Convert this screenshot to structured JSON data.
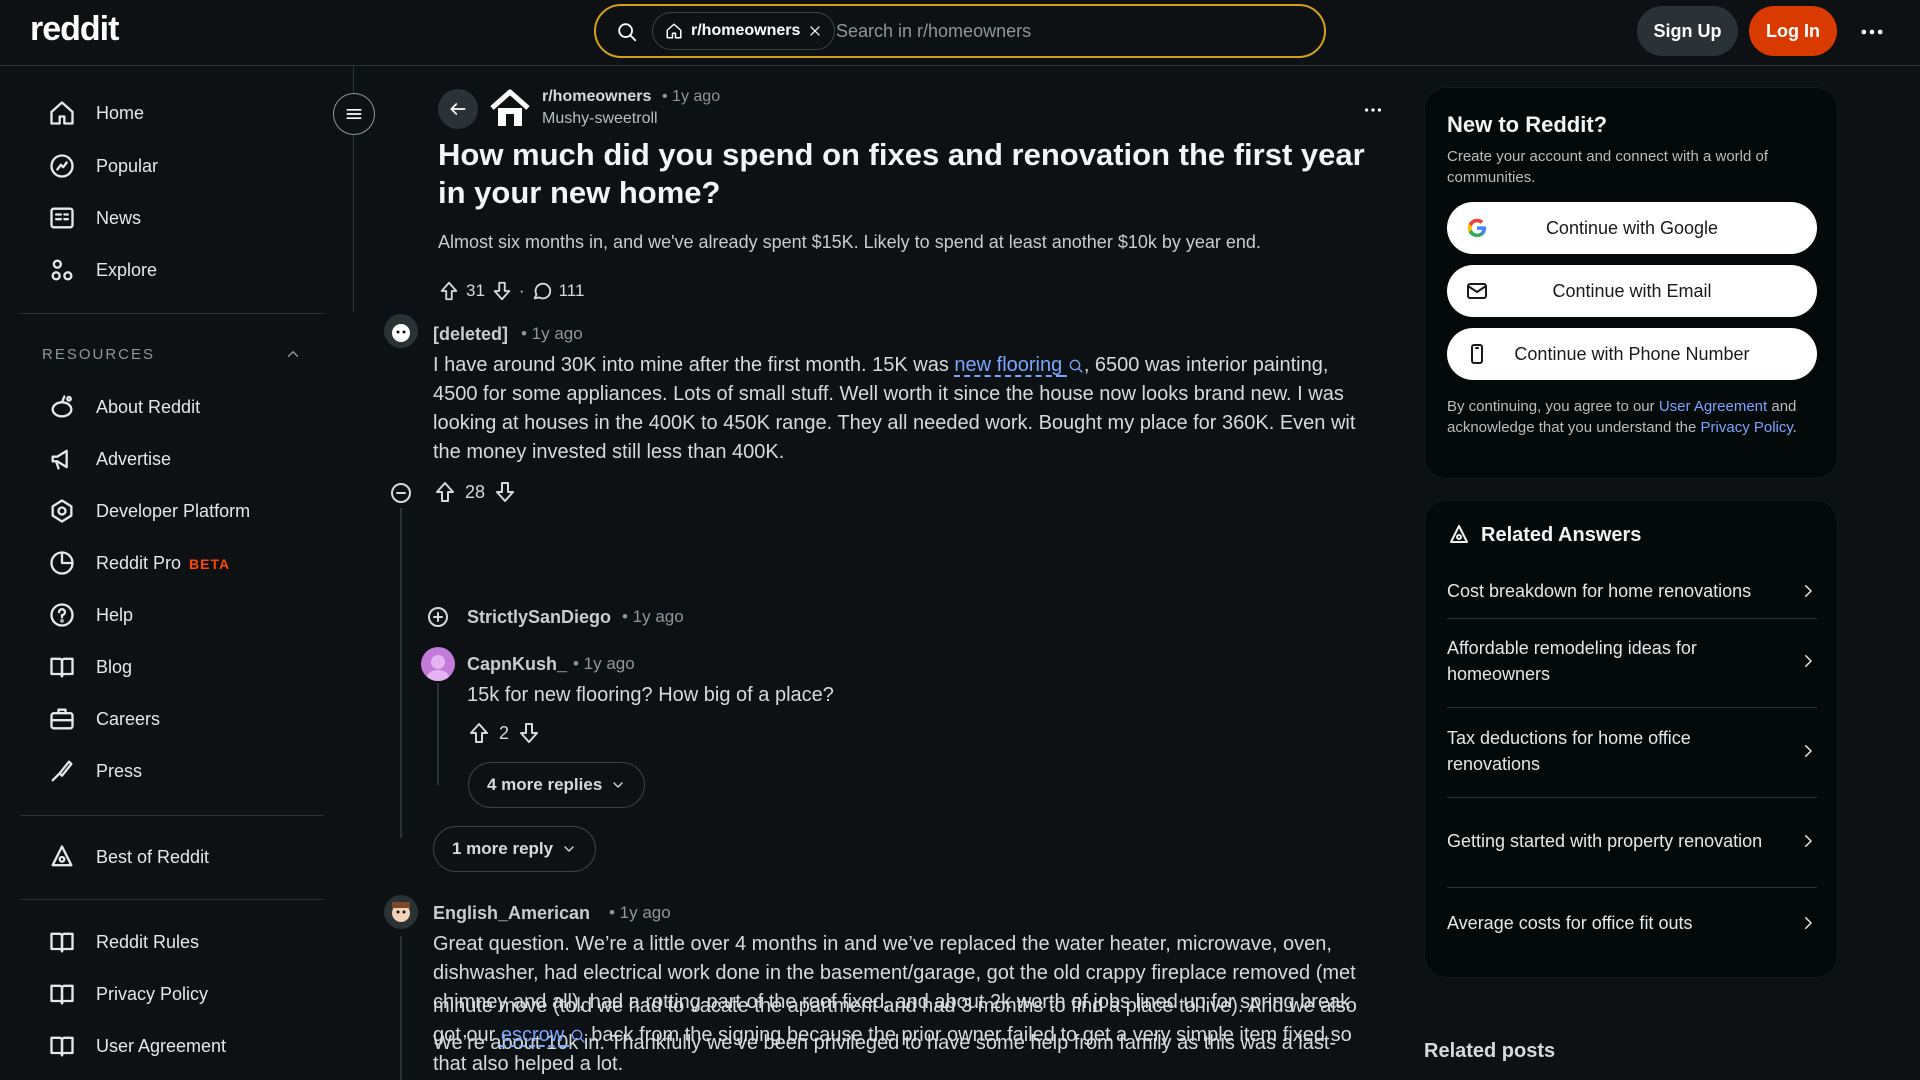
{
  "header": {
    "logo": "reddit",
    "search_chip": "r/homeowners",
    "search_placeholder": "Search in r/homeowners",
    "signup": "Sign Up",
    "login": "Log In"
  },
  "sidebar": {
    "items": [
      {
        "label": "Home",
        "icon": "home-icon"
      },
      {
        "label": "Popular",
        "icon": "popular-icon"
      },
      {
        "label": "News",
        "icon": "news-icon"
      },
      {
        "label": "Explore",
        "icon": "explore-icon"
      }
    ],
    "resources_title": "RESOURCES",
    "resources": [
      {
        "label": "About Reddit",
        "icon": "reddit-alien-icon"
      },
      {
        "label": "Advertise",
        "icon": "megaphone-icon"
      },
      {
        "label": "Developer Platform",
        "icon": "developer-icon"
      },
      {
        "label": "Reddit Pro",
        "icon": "pro-icon",
        "badge": "BETA"
      },
      {
        "label": "Help",
        "icon": "help-icon"
      },
      {
        "label": "Blog",
        "icon": "book-icon"
      },
      {
        "label": "Careers",
        "icon": "briefcase-icon"
      },
      {
        "label": "Press",
        "icon": "press-icon"
      }
    ],
    "best_of": "Best of Reddit",
    "policies": [
      {
        "label": "Reddit Rules",
        "icon": "book-icon"
      },
      {
        "label": "Privacy Policy",
        "icon": "book-icon"
      },
      {
        "label": "User Agreement",
        "icon": "book-icon"
      }
    ]
  },
  "post": {
    "subreddit": "r/homeowners",
    "time": "• 1y ago",
    "author": "Mushy-sweetroll",
    "title": "How much did you spend on fixes and renovation the first year in your new home?",
    "body": "Almost six months in, and we've already spent $15K. Likely to spend at least another $10k by year end.",
    "upvotes": "31",
    "dot": "·",
    "comments": "111"
  },
  "comments": {
    "c1": {
      "author": "[deleted]",
      "time": "• 1y ago",
      "line1_pre": "I have around 30K into mine after the first month. 15K was ",
      "line1_link": "new flooring",
      "line1_post": ", 6500 was interior painting,",
      "line2": "4500 for some appliances. Lots of small stuff. Well worth it since the house now looks brand new. I was",
      "line3": "looking at houses in the 400K to 450K range. They all needed work. Bought my place for 360K. Even wit",
      "line4": "the money invested still less than 400K.",
      "votes": "28"
    },
    "c2": {
      "author": "StrictlySanDiego",
      "time": "• 1y ago"
    },
    "c3": {
      "author": "CapnKush_",
      "time": "• 1y ago",
      "text": "15k for new flooring? How big of a place?",
      "votes": "2",
      "more": "4 more replies"
    },
    "more_reply": "1 more reply",
    "c4": {
      "author": "English_American",
      "time": "• 1y ago",
      "line1": "Great question. We’re a little over 4 months in and we’ve replaced the water heater, microwave, oven,",
      "line2": "dishwasher, had electrical work done in the basement/garage, got the old crappy fireplace removed (met",
      "line3": "chimney and all), had a rotting part of the roof fixed, and about 2k worth of jobs lined up for spring break",
      "line4": "We’re about 10k in. Thankfully we’ve been privileged to have some help from family as this was a last-",
      "line5": "minute move (told we had to vacate the apartment and had 3 months to find a place to live). And we also",
      "line6_pre": "got our ",
      "line6_link": "escrow",
      "line6_post": " back from the signing because the prior owner failed to get a very simple item fixed so",
      "line7": "that also helped a lot."
    }
  },
  "signup_card": {
    "title": "New to Reddit?",
    "desc": "Create your account and connect with a world of communities.",
    "google": "Continue with Google",
    "email": "Continue with Email",
    "phone": "Continue with Phone Number",
    "legal_1": "By continuing, you agree to our ",
    "legal_link1": "User Agreement",
    "legal_2": " and acknowledge that you understand the ",
    "legal_link2": "Privacy Policy",
    "legal_3": "."
  },
  "related": {
    "title": "Related Answers",
    "items": [
      "Cost breakdown for home renovations",
      "Affordable remodeling ideas for homeowners",
      "Tax deductions for home office renovations",
      "Getting started with property renovation",
      "Average costs for office fit outs"
    ],
    "posts_title": "Related posts"
  },
  "colors": {
    "accent": "#d93a00",
    "link": "#7aa5ff",
    "search_border": "#d4a017",
    "beta": "#ff4500"
  }
}
